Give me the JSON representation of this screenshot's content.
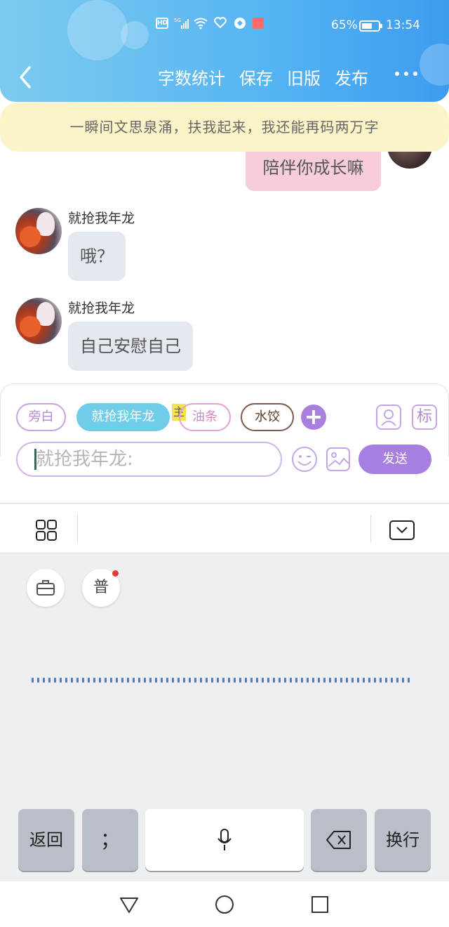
{
  "status_bar": {
    "battery_percent": "65%",
    "battery_level": 0.65,
    "time": "13:54",
    "icons": [
      "hd-icon",
      "signal-5g-icon",
      "wifi-icon",
      "health-icon",
      "app-icon",
      "book-icon"
    ]
  },
  "nav": {
    "items": [
      "字数统计",
      "保存",
      "旧版",
      "发布"
    ]
  },
  "banner": {
    "text": "一瞬间文思泉涌，扶我起来，我还能再码两万字"
  },
  "chat": {
    "my_message": "陪伴你成长嘛",
    "messages": [
      {
        "name": "就抢我年龙",
        "text": "哦？"
      },
      {
        "name": "就抢我年龙",
        "text": "自己安慰自己"
      }
    ]
  },
  "composer": {
    "chips": [
      "旁白",
      "就抢我年龙",
      "油条",
      "水饺"
    ],
    "main_tag": "主",
    "tag_button": "标",
    "input_placeholder": "就抢我年龙:",
    "send_label": "发送"
  },
  "keyboard": {
    "pu_label": "普",
    "keys": {
      "back": "返回",
      "semicolon": "；",
      "enter": "换行"
    }
  },
  "colors": {
    "header_gradient_start": "#7dcbef",
    "header_gradient_end": "#3e9cf0",
    "banner_bg": "#fbf4c8",
    "accent_purple": "#a77fe0",
    "active_chip": "#6fcdea"
  }
}
